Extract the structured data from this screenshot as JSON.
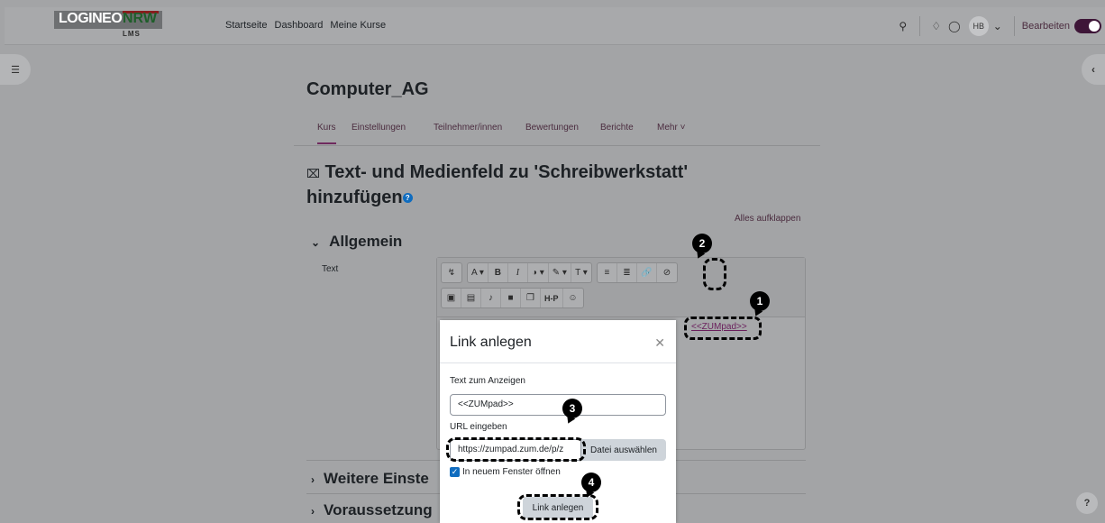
{
  "logo": {
    "part1": "LOGINEO",
    "part2": "NRW",
    "sub": "LMS"
  },
  "nav": {
    "links": [
      "Startseite",
      "Dashboard",
      "Meine Kurse"
    ],
    "avatar": "HB",
    "edit_label": "Bearbeiten"
  },
  "course": {
    "title": "Computer_AG",
    "tabs": [
      "Kurs",
      "Einstellungen",
      "Teilnehmer/innen",
      "Bewertungen",
      "Berichte",
      "Mehr"
    ]
  },
  "page": {
    "heading_line1": "Text- und Medienfeld zu 'Schreibwerkstatt'",
    "heading_line2": "hinzufügen",
    "expand_all": "Alles aufklappen",
    "section_general": "Allgemein",
    "section_more": "Weitere Einste",
    "section_prereq": "Voraussetzung",
    "field_text_label": "Text"
  },
  "editor": {
    "content_link": "<<ZUMpad>>"
  },
  "modal": {
    "title": "Link anlegen",
    "text_label": "Text zum Anzeigen",
    "text_value": "<<ZUMpad>>",
    "url_label": "URL eingeben",
    "url_value": "https://zumpad.zum.de/p/z",
    "file_button": "Datei auswählen",
    "new_window_label": "In neuem Fenster öffnen",
    "new_window_checked": true,
    "submit": "Link anlegen"
  },
  "annotations": [
    "1",
    "2",
    "3",
    "4"
  ],
  "colors": {
    "accent": "#6f2a5e",
    "primary": "#0f6cbf"
  }
}
